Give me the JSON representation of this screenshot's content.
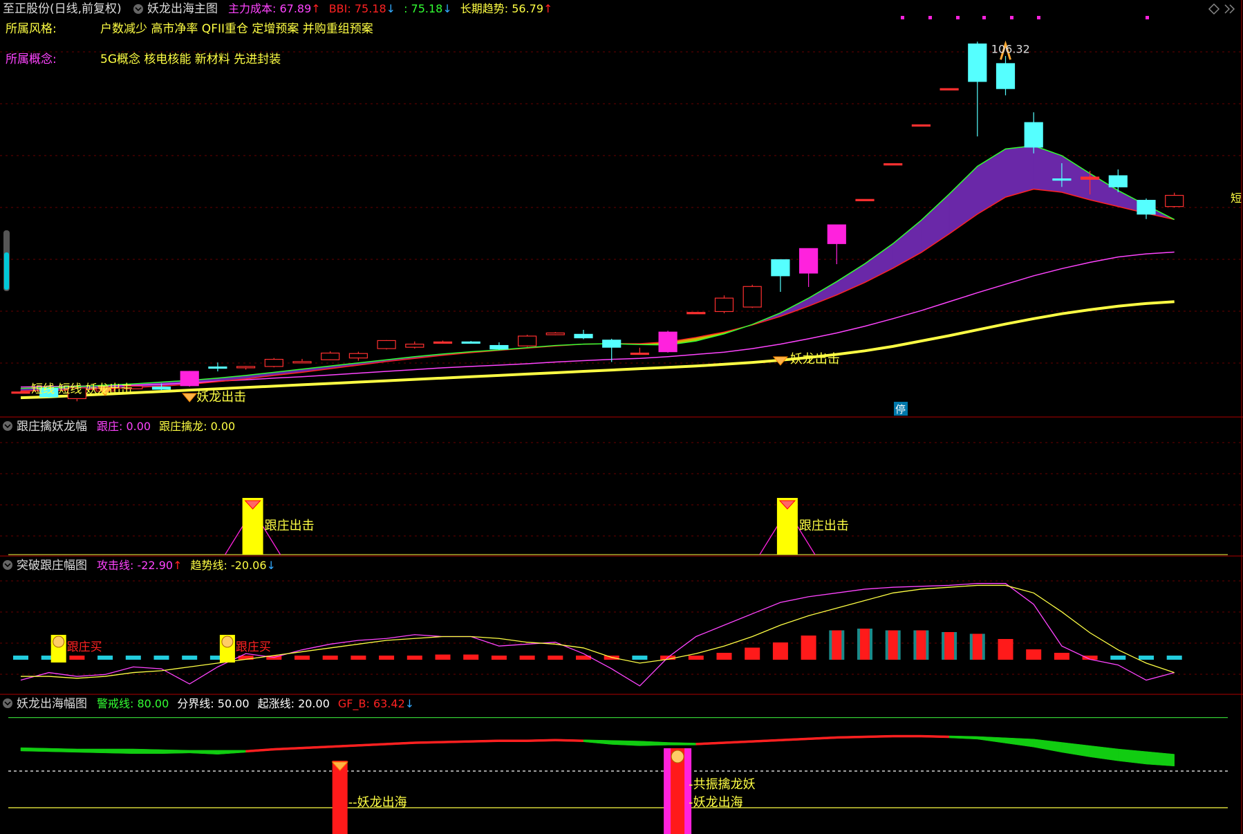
{
  "header": {
    "stock": "至正股份(日线,前复权)",
    "indicator": "妖龙出海主图",
    "items": [
      {
        "label": "主力成本",
        "value": "67.89",
        "arrow": "up",
        "color": "#ff44ff"
      },
      {
        "label": "BBI",
        "value": "75.18",
        "arrow": "down",
        "color": "#ff2222"
      },
      {
        "label": "",
        "value": "75.18",
        "arrow": "down",
        "color": "#33ff33"
      },
      {
        "label": "长期趋势",
        "value": "56.79",
        "arrow": "up",
        "color": "#ffff44"
      }
    ],
    "style_label": "所属风格:",
    "style_value": "户数减少 高市净率 QFII重仓 定增预案 并购重组预案",
    "concept_label": "所属概念:",
    "concept_value": "5G概念 核电核能 新材料 先进封装"
  },
  "panel1": {
    "title": "跟庄擒妖龙幅",
    "items": [
      {
        "label": "跟庄",
        "value": "0.00",
        "color": "#ff44ff"
      },
      {
        "label": "跟庄擒龙",
        "value": "0.00",
        "color": "#ffff44"
      }
    ],
    "signal": "跟庄出击"
  },
  "panel2": {
    "title": "突破跟庄幅图",
    "items": [
      {
        "label": "攻击线",
        "value": "-22.90",
        "arrow": "up",
        "color": "#ff44ff"
      },
      {
        "label": "趋势线",
        "value": "-20.06",
        "arrow": "down",
        "color": "#ffff44"
      }
    ],
    "signal": "跟庄买"
  },
  "panel3": {
    "title": "妖龙出海幅图",
    "items": [
      {
        "label": "警戒线",
        "value": "80.00",
        "color": "#33ff33"
      },
      {
        "label": "分界线",
        "value": "50.00",
        "color": "#ffffff"
      },
      {
        "label": "起涨线",
        "value": "20.00",
        "color": "#ffffff"
      },
      {
        "label": "GF_B",
        "value": "63.42",
        "arrow": "down",
        "color": "#ff2222"
      }
    ],
    "signal1": "妖龙出海",
    "signal2": "共振擒龙妖"
  },
  "main_labels": {
    "peak": "106.32",
    "signal_main": "妖龙出击",
    "signal_left": "妖龙出击",
    "left_text": "短线 短线 妖龙出击",
    "stop": "停",
    "edge": "短"
  },
  "chart_data": {
    "type": "candlestick",
    "title": "妖龙出海主图",
    "candles": [
      {
        "o": 36.6,
        "c": 36.6,
        "h": 36.8,
        "l": 36.4,
        "color": "red"
      },
      {
        "o": 35.5,
        "c": 37.4,
        "h": 37.6,
        "l": 35.3,
        "color": "cyan"
      },
      {
        "o": 35.1,
        "c": 37.5,
        "h": 37.8,
        "l": 34.5,
        "color": "red"
      },
      {
        "o": 36.8,
        "c": 37.3,
        "h": 37.6,
        "l": 36.7,
        "color": "red"
      },
      {
        "o": 37.3,
        "c": 37.9,
        "h": 38.0,
        "l": 37.2,
        "color": "red"
      },
      {
        "o": 37.2,
        "c": 37.7,
        "h": 38.5,
        "l": 37.0,
        "color": "cyan"
      },
      {
        "o": 38.0,
        "c": 41.2,
        "h": 41.3,
        "l": 37.8,
        "color": "magenta"
      },
      {
        "o": 42.2,
        "c": 42.2,
        "h": 43.2,
        "l": 41.2,
        "color": "cyan"
      },
      {
        "o": 42.0,
        "c": 42.3,
        "h": 42.4,
        "l": 41.6,
        "color": "red"
      },
      {
        "o": 42.3,
        "c": 43.9,
        "h": 44.2,
        "l": 42.1,
        "color": "red"
      },
      {
        "o": 43.3,
        "c": 43.4,
        "h": 44.0,
        "l": 43.0,
        "color": "red"
      },
      {
        "o": 43.8,
        "c": 45.3,
        "h": 45.7,
        "l": 43.7,
        "color": "red"
      },
      {
        "o": 44.2,
        "c": 45.2,
        "h": 45.6,
        "l": 43.6,
        "color": "red"
      },
      {
        "o": 46.3,
        "c": 48.1,
        "h": 48.2,
        "l": 46.1,
        "color": "red"
      },
      {
        "o": 46.6,
        "c": 47.3,
        "h": 47.9,
        "l": 46.3,
        "color": "red"
      },
      {
        "o": 47.8,
        "c": 47.8,
        "h": 48.1,
        "l": 47.6,
        "color": "red"
      },
      {
        "o": 47.8,
        "c": 47.7,
        "h": 48.0,
        "l": 47.5,
        "color": "cyan"
      },
      {
        "o": 47.0,
        "c": 46.2,
        "h": 47.7,
        "l": 46.0,
        "color": "cyan"
      },
      {
        "o": 46.9,
        "c": 49.1,
        "h": 49.4,
        "l": 46.7,
        "color": "red"
      },
      {
        "o": 49.4,
        "c": 49.8,
        "h": 50.0,
        "l": 49.3,
        "color": "red"
      },
      {
        "o": 49.5,
        "c": 48.7,
        "h": 50.5,
        "l": 48.4,
        "color": "cyan"
      },
      {
        "o": 48.2,
        "c": 46.6,
        "h": 48.5,
        "l": 43.3,
        "color": "cyan"
      },
      {
        "o": 45.3,
        "c": 45.3,
        "h": 46.5,
        "l": 45.0,
        "color": "red"
      },
      {
        "o": 45.6,
        "c": 50.0,
        "h": 50.3,
        "l": 45.4,
        "color": "magenta"
      },
      {
        "o": 54.4,
        "c": 54.4,
        "h": 54.4,
        "l": 54.4,
        "color": "red"
      },
      {
        "o": 54.6,
        "c": 57.6,
        "h": 58.2,
        "l": 54.2,
        "color": "red"
      },
      {
        "o": 55.6,
        "c": 60.2,
        "h": 60.6,
        "l": 55.4,
        "color": "red"
      },
      {
        "o": 62.6,
        "c": 66.2,
        "h": 66.2,
        "l": 59.0,
        "color": "cyan"
      },
      {
        "o": 63.2,
        "c": 68.7,
        "h": 68.7,
        "l": 60.1,
        "color": "magenta"
      },
      {
        "o": 69.8,
        "c": 74.0,
        "h": 74.0,
        "l": 65.2,
        "color": "magenta"
      },
      {
        "o": 79.7,
        "c": 79.7,
        "h": 79.7,
        "l": 79.7,
        "color": "red"
      },
      {
        "o": 87.7,
        "c": 87.7,
        "h": 87.7,
        "l": 87.7,
        "color": "red"
      },
      {
        "o": 96.4,
        "c": 96.4,
        "h": 96.4,
        "l": 96.4,
        "color": "red"
      },
      {
        "o": 104.5,
        "c": 104.5,
        "h": 104.5,
        "l": 104.5,
        "color": "red"
      },
      {
        "o": 106.1,
        "c": 114.5,
        "h": 115.0,
        "l": 93.8,
        "color": "cyan"
      },
      {
        "o": 110.1,
        "c": 104.5,
        "h": 111.8,
        "l": 103.0,
        "color": "cyan"
      },
      {
        "o": 96.9,
        "c": 91.4,
        "h": 99.2,
        "l": 90.0,
        "color": "cyan"
      },
      {
        "o": 84.3,
        "c": 84.3,
        "h": 87.8,
        "l": 82.5,
        "color": "cyan"
      },
      {
        "o": 84.7,
        "c": 84.2,
        "h": 86.1,
        "l": 80.8,
        "color": "red"
      },
      {
        "o": 85.0,
        "c": 82.5,
        "h": 86.4,
        "l": 81.3,
        "color": "cyan"
      },
      {
        "o": 79.5,
        "c": 76.4,
        "h": 79.9,
        "l": 75.3,
        "color": "cyan"
      },
      {
        "o": 78.1,
        "c": 80.6,
        "h": 81.2,
        "l": 77.9,
        "color": "red"
      }
    ],
    "series": [
      {
        "name": "主力成本",
        "color": "#ff44ff",
        "values": [
          37.7,
          37.8,
          37.9,
          38.0,
          38.1,
          38.3,
          38.6,
          39.0,
          39.3,
          39.7,
          40.0,
          40.4,
          40.8,
          41.2,
          41.6,
          42.0,
          42.3,
          42.6,
          42.9,
          43.3,
          43.6,
          43.9,
          44.1,
          44.5,
          45.0,
          45.5,
          46.3,
          47.3,
          48.5,
          49.8,
          51.3,
          53.0,
          54.8,
          56.8,
          58.8,
          60.7,
          62.6,
          64.2,
          65.6,
          66.8,
          67.5,
          67.9
        ]
      },
      {
        "name": "长期趋势",
        "color": "#ffff44",
        "values": [
          35.3,
          35.5,
          35.8,
          36.1,
          36.4,
          36.7,
          37.0,
          37.3,
          37.6,
          37.9,
          38.2,
          38.5,
          38.8,
          39.1,
          39.4,
          39.7,
          40.0,
          40.3,
          40.6,
          40.9,
          41.2,
          41.5,
          41.8,
          42.1,
          42.4,
          42.8,
          43.2,
          43.7,
          44.3,
          45.0,
          45.8,
          46.8,
          48.0,
          49.2,
          50.5,
          51.8,
          53.0,
          54.1,
          55.0,
          55.8,
          56.4,
          56.8
        ]
      },
      {
        "name": "BBI",
        "color": "#ff2222",
        "values": [
          36.8,
          36.9,
          37.1,
          37.3,
          37.6,
          37.9,
          38.3,
          38.9,
          39.5,
          40.3,
          41.0,
          41.8,
          42.6,
          43.4,
          44.1,
          44.8,
          45.4,
          45.9,
          46.4,
          46.9,
          47.3,
          47.4,
          47.4,
          47.8,
          48.8,
          50.0,
          51.6,
          53.5,
          55.8,
          58.3,
          61.1,
          64.3,
          67.8,
          72.0,
          76.4,
          80.2,
          82.0,
          81.3,
          79.6,
          78.1,
          76.6,
          75.2
        ]
      },
      {
        "name": "",
        "color": "#33ff33",
        "values": [
          37.4,
          37.6,
          37.8,
          38.1,
          38.4,
          38.8,
          39.2,
          39.7,
          40.3,
          41.0,
          41.7,
          42.4,
          43.1,
          43.8,
          44.5,
          45.1,
          45.6,
          46.0,
          46.5,
          47.0,
          47.3,
          47.4,
          47.2,
          47.1,
          48.0,
          49.6,
          51.7,
          54.3,
          57.6,
          61.3,
          65.3,
          69.8,
          75.0,
          80.9,
          87.1,
          91.0,
          91.7,
          89.5,
          85.5,
          81.7,
          78.4,
          75.2
        ]
      }
    ],
    "ylim": [
      33,
      120
    ]
  },
  "panel1_data": {
    "type": "bar",
    "signal_bars_index": [
      8,
      27
    ],
    "values": [
      0,
      0
    ]
  },
  "panel2_data": {
    "type": "line",
    "series": [
      {
        "name": "攻击线",
        "color": "#ff44ff",
        "values": [
          -24,
          -20,
          -22,
          -21,
          -17,
          -18,
          -26,
          -17,
          -10,
          -12,
          -8,
          -5,
          -3,
          -2,
          0,
          -1,
          -1,
          -6,
          -5,
          -4,
          -10,
          -18,
          -27,
          -12,
          -1,
          5,
          11,
          17,
          20,
          22,
          24,
          25,
          25.5,
          26,
          27,
          27,
          16,
          -6,
          -13,
          -16,
          -24,
          -20
        ]
      },
      {
        "name": "趋势线",
        "color": "#ffff44",
        "values": [
          -22,
          -22,
          -23,
          -22,
          -20,
          -19,
          -17,
          -15,
          -13,
          -11,
          -9,
          -7,
          -5,
          -3,
          -2,
          -1,
          -1,
          -2,
          -4,
          -5,
          -7,
          -12,
          -15,
          -13,
          -10,
          -6,
          -1,
          5,
          10,
          14,
          18,
          22,
          24,
          25,
          26,
          26,
          22,
          12,
          1,
          -8,
          -15,
          -20
        ]
      }
    ],
    "bars": [
      -1,
      -1,
      1,
      -1,
      -1,
      -1,
      -1,
      -1,
      0.5,
      0.5,
      1,
      1,
      1,
      1,
      1,
      1.5,
      1.5,
      1.2,
      1,
      1,
      1,
      1,
      -1,
      0.5,
      1,
      2,
      3.5,
      5,
      7,
      8.5,
      9,
      8.5,
      8.5,
      8,
      7.5,
      6,
      3,
      2,
      1,
      -1,
      -2,
      -2.5
    ],
    "ylim": [
      -30,
      32
    ]
  },
  "panel3_data": {
    "type": "area",
    "series": [
      {
        "name": "GF_B",
        "color": "#ff2222",
        "values": [
          60,
          59,
          58,
          57,
          56,
          56,
          58,
          55,
          58,
          61,
          63,
          65,
          67,
          69,
          71,
          72,
          73,
          74,
          74,
          75,
          74,
          70,
          68,
          69,
          69,
          71,
          73,
          75,
          77,
          79,
          80,
          81,
          81,
          80,
          78,
          72,
          66,
          58,
          51,
          45,
          40,
          37
        ]
      },
      {
        "name": "GF_A",
        "color": "#33ff33",
        "values": [
          62,
          61,
          60,
          60,
          60,
          59,
          57,
          58,
          58,
          61,
          63,
          65,
          67,
          69,
          71,
          72,
          73,
          74,
          74,
          75,
          74,
          73,
          72,
          70,
          69,
          71,
          73,
          75,
          77,
          79,
          80,
          81,
          81,
          80,
          79,
          77,
          75,
          70,
          65,
          60,
          56,
          52
        ]
      }
    ],
    "levels": {
      "warning": 80,
      "divide": 50,
      "start": 20
    },
    "signal_index": [
      11,
      23
    ],
    "ylim": [
      0,
      100
    ]
  }
}
